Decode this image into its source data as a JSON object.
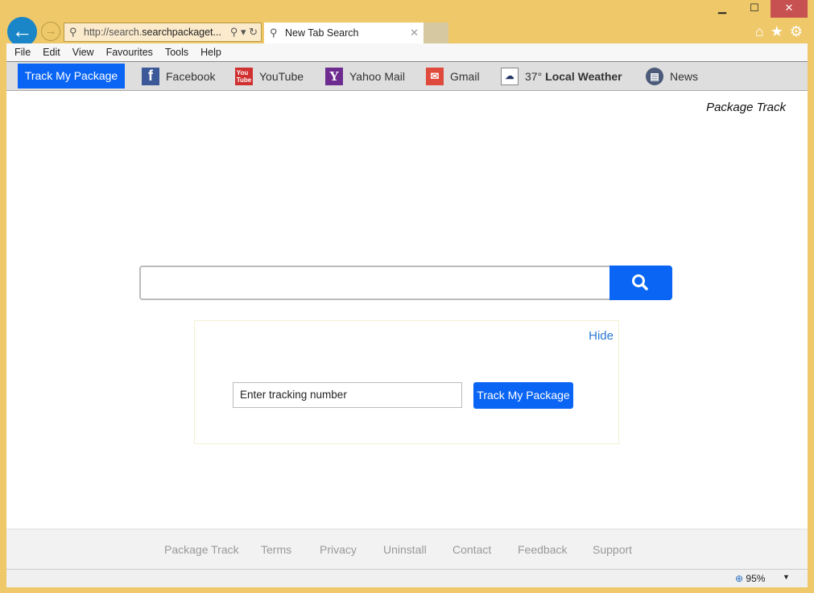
{
  "browser": {
    "url_prefix": "http://search.",
    "url_domain": "searchpackaget...",
    "tab_title": "New Tab Search",
    "zoom": "95%"
  },
  "menu": [
    "File",
    "Edit",
    "View",
    "Favourites",
    "Tools",
    "Help"
  ],
  "toolbar": {
    "track_button": "Track My Package",
    "links": [
      "Facebook",
      "YouTube",
      "Yahoo Mail",
      "Gmail"
    ],
    "weather_temp": "37°",
    "weather_label": "Local Weather",
    "news": "News"
  },
  "page": {
    "brand": "Package Track",
    "hide": "Hide",
    "tracking_placeholder": "Enter tracking number",
    "track_button": "Track My Package"
  },
  "footer": [
    "Package Track",
    "Terms",
    "Privacy",
    "Uninstall",
    "Contact",
    "Feedback",
    "Support"
  ]
}
